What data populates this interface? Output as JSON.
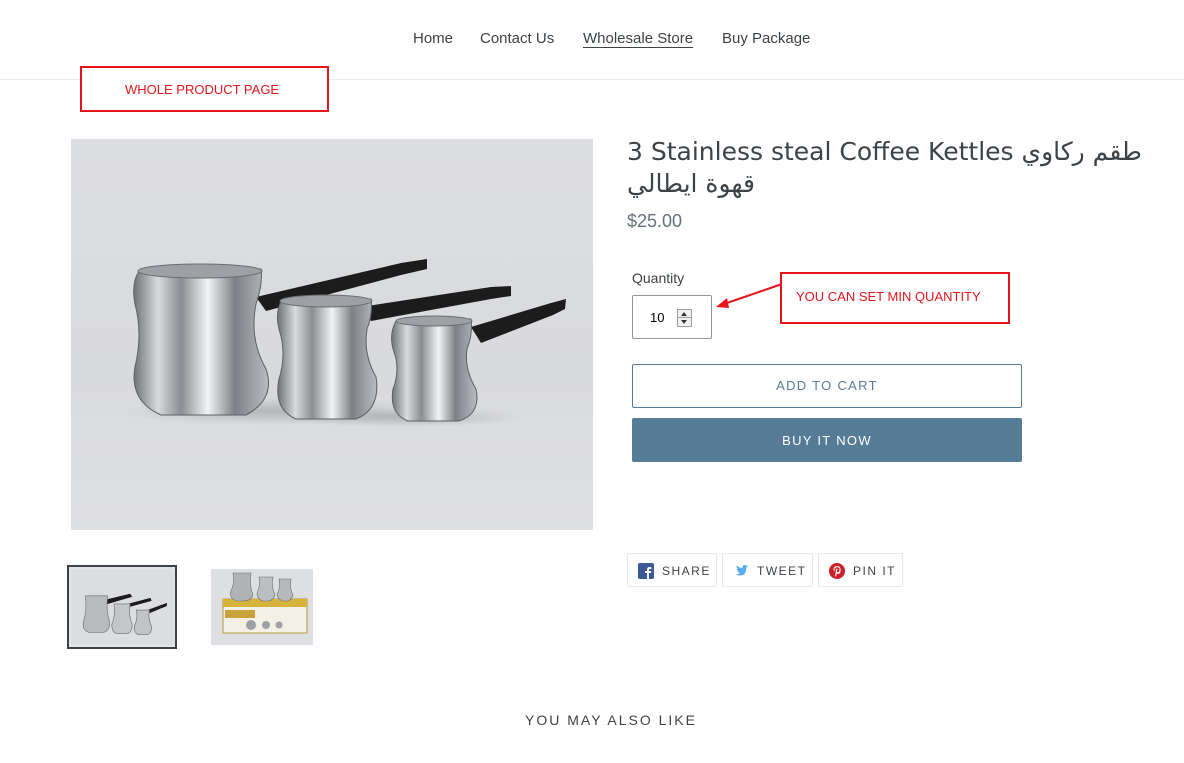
{
  "nav": {
    "items": [
      {
        "label": "Home"
      },
      {
        "label": "Contact Us"
      },
      {
        "label": "Wholesale Store",
        "active": true
      },
      {
        "label": "Buy Package"
      }
    ]
  },
  "annotations": {
    "page_label": "WHOLE PRODUCT PAGE",
    "quantity_note": "YOU CAN SET MIN QUANTITY",
    "color": "#e4151b"
  },
  "product": {
    "title": "3 Stainless steal Coffee Kettles طقم ركاوي قهوة ايطالي",
    "price": "$25.00",
    "quantity_label": "Quantity",
    "quantity_value": "10",
    "add_to_cart": "ADD TO CART",
    "buy_now": "BUY IT NOW"
  },
  "share": {
    "facebook": "SHARE",
    "twitter": "TWEET",
    "pinterest": "PIN IT"
  },
  "related": {
    "heading": "YOU MAY ALSO LIKE"
  },
  "colors": {
    "accent": "#557b97",
    "text": "#3d4246",
    "price": "#69727b"
  },
  "icons": [
    "facebook-icon",
    "twitter-icon",
    "pinterest-icon",
    "arrow-icon"
  ]
}
